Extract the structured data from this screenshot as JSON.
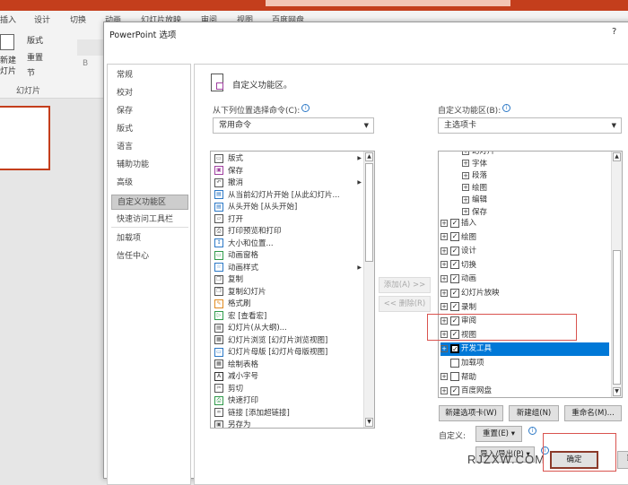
{
  "ribbon": {
    "tabs": [
      "插入",
      "设计",
      "切换",
      "动画",
      "幻灯片放映",
      "审阅",
      "视图",
      "百度网盘"
    ],
    "layout": "版式",
    "reset": "重置",
    "section": "节",
    "new_slide_1": "新建",
    "new_slide_2": "灯片",
    "group": "幻灯片",
    "bold": "B"
  },
  "dialog": {
    "title": "PowerPoint 选项",
    "help": "?"
  },
  "nav": [
    "常规",
    "校对",
    "保存",
    "版式",
    "语言",
    "辅助功能",
    "高级",
    "自定义功能区",
    "快速访问工具栏",
    "加载项",
    "信任中心"
  ],
  "panel": {
    "heading": "自定义功能区。",
    "choose_label": "从下列位置选择命令(C):",
    "choose_value": "常用命令",
    "customize_label": "自定义功能区(B):",
    "customize_value": "主选项卡",
    "commands": [
      "版式",
      "保存",
      "撤消",
      "从当前幻灯片开始 [从此幻灯片...",
      "从头开始 [从头开始]",
      "打开",
      "打印预览和打印",
      "大小和位置...",
      "动画窗格",
      "动画样式",
      "复制",
      "复制幻灯片",
      "格式刷",
      "宏 [查看宏]",
      "幻灯片(从大纲)...",
      "幻灯片浏览 [幻灯片浏览视图]",
      "幻灯片母版 [幻灯片母版视图]",
      "绘制表格",
      "减小字号",
      "剪切",
      "快速打印",
      "链接 [添加超链接]",
      "另存为"
    ],
    "add": "添加(A) >>",
    "remove": "<< 删除(R)",
    "tree_sub": [
      "幻灯片",
      "字体",
      "段落",
      "绘图",
      "编辑",
      "保存"
    ],
    "tree": [
      {
        "label": "插入",
        "checked": true
      },
      {
        "label": "绘图",
        "checked": true
      },
      {
        "label": "设计",
        "checked": true
      },
      {
        "label": "切换",
        "checked": true
      },
      {
        "label": "动画",
        "checked": true
      },
      {
        "label": "幻灯片放映",
        "checked": true
      },
      {
        "label": "录制",
        "checked": true
      },
      {
        "label": "审阅",
        "checked": true
      },
      {
        "label": "视图",
        "checked": true
      },
      {
        "label": "开发工具",
        "checked": true
      },
      {
        "label": "加载项",
        "checked": false
      },
      {
        "label": "帮助",
        "checked": false
      },
      {
        "label": "百度网盘",
        "checked": true
      }
    ],
    "new_tab": "新建选项卡(W)",
    "new_group": "新建组(N)",
    "rename": "重命名(M)...",
    "customize": "自定义:",
    "reset": "重置(E) ▾",
    "import_export": "导入/导出(P) ▾"
  },
  "footer": {
    "ok": "确定",
    "cancel": "取",
    "watermark": "RJZXW.COM"
  }
}
